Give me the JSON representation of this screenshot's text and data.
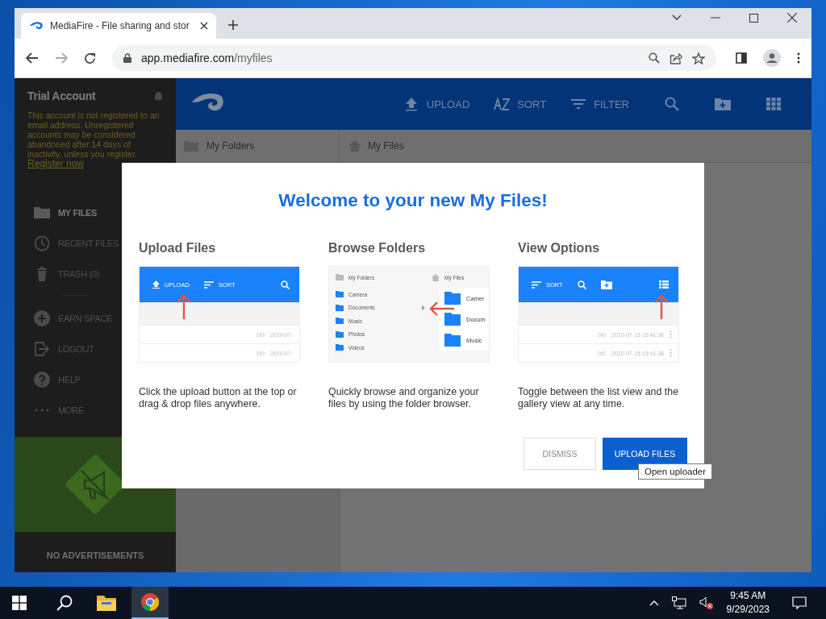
{
  "browser": {
    "tab_title": "MediaFire - File sharing and stor",
    "url_host": "app.mediafire.com",
    "url_path": "/myfiles"
  },
  "sidebar": {
    "account": "Trial Account",
    "notice": "This account is not registered to an email address. Unregistered accounts may be considered abandoned after 14 days of inactivity, unless you register.",
    "register_link": "Register now",
    "items": [
      {
        "label": "MY FILES",
        "selected": true
      },
      {
        "label": "RECENT FILES",
        "selected": false
      },
      {
        "label": "TRASH (0)",
        "selected": false
      },
      {
        "label": "EARN SPACE",
        "selected": false
      },
      {
        "label": "LOGOUT",
        "selected": false
      },
      {
        "label": "HELP",
        "selected": false
      },
      {
        "label": "MORE",
        "selected": false
      }
    ],
    "promo": "NO ADVERTISEMENTS"
  },
  "toolbar": {
    "actions": [
      "UPLOAD",
      "SORT",
      "FILTER"
    ]
  },
  "breadcrumbs": {
    "folders": "My Folders",
    "files": "My Files"
  },
  "dialog": {
    "title": "Welcome to your new My Files!",
    "columns": [
      {
        "kind": "upload",
        "heading": "Upload Files",
        "caption": "Click the upload button at the top or drag & drop files anywhere.",
        "preview": {
          "bar": [
            "UPLOAD",
            "SORT"
          ],
          "rows": [
            "2020-07-",
            "2020-07-"
          ]
        }
      },
      {
        "kind": "browse",
        "heading": "Browse Folders",
        "caption": "Quickly browse and organize your files by using the folder browser.",
        "preview": {
          "left_title": "My Folders",
          "right_title": "My Files",
          "folders": [
            "Camera",
            "Documents",
            "Music",
            "Photos",
            "Videos"
          ],
          "tiles": [
            "Camer",
            "Docum",
            "Music"
          ]
        }
      },
      {
        "kind": "view",
        "heading": "View Options",
        "caption": "Toggle between the list view and the gallery view at any time.",
        "preview": {
          "bar": [
            "SORT"
          ],
          "rows": [
            "2020-07-15 15:41:38",
            "2020-07-15 15:41:38"
          ]
        }
      }
    ],
    "buttons": {
      "dismiss": "DISMISS",
      "confirm": "UPLOAD FILES"
    }
  },
  "tooltip": "Open uploader",
  "taskbar": {
    "time": "9:45 AM",
    "date": "9/29/2023"
  }
}
